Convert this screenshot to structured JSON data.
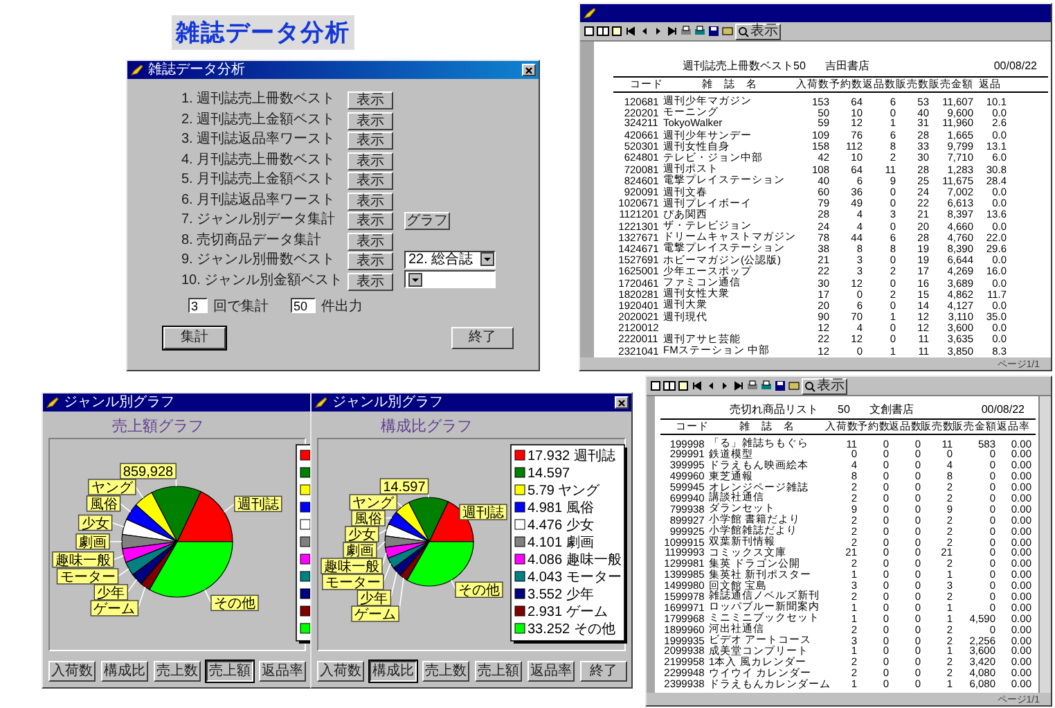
{
  "heading": "雑誌データ分析",
  "dialog": {
    "title": "雑誌データ分析",
    "items": [
      {
        "label": "1. 週刊誌売上冊数ベスト",
        "button": "表示"
      },
      {
        "label": "2. 週刊誌売上金額ベスト",
        "button": "表示"
      },
      {
        "label": "3. 週刊誌返品率ワースト",
        "button": "表示"
      },
      {
        "label": "4. 月刊誌売上冊数ベスト",
        "button": "表示"
      },
      {
        "label": "5. 月刊誌売上金額ベスト",
        "button": "表示"
      },
      {
        "label": "6. 月刊誌返品率ワースト",
        "button": "表示"
      },
      {
        "label": "7. ジャンル別データ集計",
        "button": "表示",
        "extra": {
          "kind": "button",
          "label": "グラフ"
        }
      },
      {
        "label": "8. 売切商品データ集計",
        "button": "表示"
      },
      {
        "label": "9. ジャンル別冊数ベスト",
        "button": "表示",
        "extra": {
          "kind": "dropdown",
          "value": "22. 総合誌"
        }
      },
      {
        "label": "10. ジャンル別金額ベスト",
        "button": "表示",
        "extra": {
          "kind": "dropdown"
        }
      }
    ],
    "period": {
      "value": "3",
      "label": "回で集計"
    },
    "count": {
      "value": "50",
      "label": "件出力"
    },
    "buttons": [
      "集計",
      "終了"
    ]
  },
  "reports": [
    {
      "toolbar_button": "表示",
      "title": "週刊誌売上冊数ベスト50",
      "store": "吉田書店",
      "date": "00/08/22",
      "page": "ページ1/1",
      "columns": [
        "",
        "コード",
        "雑　誌　名",
        "入荷数",
        "予約数",
        "返品数",
        "販売数",
        "販売金額",
        "返品"
      ],
      "rows": [
        [
          "1",
          "20681",
          "週刊少年マガジン",
          "153",
          "64",
          "6",
          "53",
          "11,607",
          "10.1"
        ],
        [
          "2",
          "20201",
          "モーニング",
          "50",
          "10",
          "0",
          "40",
          "9,600",
          "0.0"
        ],
        [
          "3",
          "24211",
          "TokyoWalker",
          "59",
          "12",
          "1",
          "31",
          "11,960",
          "2.6"
        ],
        [
          "4",
          "20661",
          "週刊少年サンデー",
          "109",
          "76",
          "6",
          "28",
          "1,665",
          "0.0"
        ],
        [
          "5",
          "20301",
          "週刊女性自身",
          "158",
          "112",
          "8",
          "33",
          "9,799",
          "13.1"
        ],
        [
          "6",
          "24801",
          "テレビ・ジョン中部",
          "42",
          "10",
          "2",
          "30",
          "7,710",
          "6.0"
        ],
        [
          "7",
          "20081",
          "週刊ポスト",
          "108",
          "64",
          "11",
          "28",
          "1,283",
          "30.8"
        ],
        [
          "8",
          "24601",
          "電撃プレイステーション",
          "40",
          "6",
          "9",
          "25",
          "11,675",
          "28.4"
        ],
        [
          "9",
          "20091",
          "週刊文春",
          "60",
          "36",
          "0",
          "24",
          "7,002",
          "0.0"
        ],
        [
          "10",
          "20671",
          "週刊プレイボーイ",
          "79",
          "49",
          "0",
          "22",
          "6,613",
          "0.0"
        ],
        [
          "11",
          "21201",
          "ぴあ関西",
          "28",
          "4",
          "3",
          "21",
          "8,397",
          "13.6"
        ],
        [
          "12",
          "21301",
          "ザ・テレビジョン",
          "24",
          "4",
          "0",
          "20",
          "4,660",
          "0.0"
        ],
        [
          "13",
          "27671",
          "ドリームキャストマガジン",
          "78",
          "44",
          "6",
          "28",
          "4,760",
          "22.0"
        ],
        [
          "14",
          "24671",
          "電撃プレイステーション",
          "38",
          "8",
          "8",
          "19",
          "8,390",
          "29.6"
        ],
        [
          "15",
          "27691",
          "ホビーマガジン(公認版)",
          "21",
          "3",
          "0",
          "19",
          "6,644",
          "0.0"
        ],
        [
          "16",
          "25001",
          "少年エースポップ",
          "22",
          "3",
          "2",
          "17",
          "4,269",
          "16.0"
        ],
        [
          "17",
          "20461",
          "ファミコン通信",
          "30",
          "12",
          "0",
          "16",
          "3,689",
          "0.0"
        ],
        [
          "18",
          "20281",
          "週刊女性大衆",
          "17",
          "0",
          "2",
          "15",
          "4,862",
          "11.7"
        ],
        [
          "19",
          "20401",
          "週刊大衆",
          "20",
          "6",
          "0",
          "14",
          "4,127",
          "0.0"
        ],
        [
          "20",
          "20021",
          "週刊現代",
          "90",
          "70",
          "1",
          "12",
          "3,110",
          "35.0"
        ],
        [
          "21",
          "20012",
          null,
          "12",
          "4",
          "0",
          "12",
          "3,600",
          "0.0"
        ],
        [
          "22",
          "20011",
          "週刊アサヒ芸能",
          "22",
          "12",
          "0",
          "11",
          "3,635",
          "0.0"
        ],
        [
          "23",
          "21041",
          "FMステーション 中部",
          "12",
          "0",
          "1",
          "11",
          "3,850",
          "8.3"
        ]
      ]
    },
    {
      "toolbar_button": "表示",
      "title": "売切れ商品リスト",
      "count": "50",
      "store": "文創書店",
      "date": "00/08/22",
      "page": "ページ1/1",
      "columns": [
        "",
        "コード",
        "雑　誌　名",
        "入荷数",
        "予約数",
        "返品数",
        "販売数",
        "販売金額",
        "返品率"
      ],
      "rows": [
        [
          "1",
          "99998",
          "「る」雑誌ちもぐら",
          "11",
          "0",
          "0",
          "11",
          "583",
          "0.00"
        ],
        [
          "2",
          "99991",
          "鉄道模型",
          "0",
          "0",
          "0",
          "0",
          "0",
          "0.00"
        ],
        [
          "3",
          "99995",
          "ドラえもん映画絵本",
          "4",
          "0",
          "0",
          "4",
          "0",
          "0.00"
        ],
        [
          "4",
          "99960",
          "東芝通報",
          "8",
          "0",
          "0",
          "8",
          "0",
          "0.00"
        ],
        [
          "5",
          "99945",
          "オレンジページ雑誌",
          "2",
          "0",
          "0",
          "2",
          "0",
          "0.00"
        ],
        [
          "6",
          "99940",
          "講談社通信",
          "2",
          "0",
          "0",
          "2",
          "0",
          "0.00"
        ],
        [
          "7",
          "99938",
          "ダランセット",
          "9",
          "0",
          "0",
          "9",
          "0",
          "0.00"
        ],
        [
          "8",
          "99927",
          "小学館 書籍だより",
          "2",
          "0",
          "0",
          "2",
          "0",
          "0.00"
        ],
        [
          "9",
          "99925",
          "小学館雑誌だより",
          "2",
          "0",
          "0",
          "2",
          "0",
          "0.00"
        ],
        [
          "10",
          "99915",
          "双葉新刊情報",
          "2",
          "0",
          "0",
          "2",
          "0",
          "0.00"
        ],
        [
          "11",
          "99993",
          "コミックス文庫",
          "21",
          "0",
          "0",
          "21",
          "0",
          "0.00"
        ],
        [
          "12",
          "99981",
          "集英 ドラゴン公開",
          "2",
          "0",
          "0",
          "2",
          "0",
          "0.00"
        ],
        [
          "13",
          "99985",
          "集英社 新刊ポスター",
          "1",
          "0",
          "0",
          "1",
          "0",
          "0.00"
        ],
        [
          "14",
          "99980",
          "回文館 宝島",
          "3",
          "0",
          "0",
          "3",
          "0",
          "0.00"
        ],
        [
          "15",
          "99978",
          "雑誌通信ノベルズ新刊",
          "2",
          "0",
          "0",
          "2",
          "0",
          "0.00"
        ],
        [
          "16",
          "99971",
          "ロッパブルー新聞案内",
          "1",
          "0",
          "0",
          "1",
          "0",
          "0.00"
        ],
        [
          "17",
          "99968",
          "ミニミニブックセット",
          "1",
          "0",
          "0",
          "1",
          "4,590",
          "0.00"
        ],
        [
          "18",
          "99960",
          "河出社通信",
          "2",
          "0",
          "0",
          "2",
          "0",
          "0.00"
        ],
        [
          "19",
          "99935",
          "ビデオ アートコース",
          "3",
          "0",
          "0",
          "2",
          "2,256",
          "0.00"
        ],
        [
          "20",
          "99938",
          "成美堂コンプリート",
          "1",
          "0",
          "0",
          "1",
          "3,600",
          "0.00"
        ],
        [
          "21",
          "99958",
          "1本入 風カレンダー",
          "2",
          "0",
          "0",
          "2",
          "3,420",
          "0.00"
        ],
        [
          "22",
          "99948",
          "ウイウイ カレンダー",
          "2",
          "0",
          "0",
          "2",
          "4,080",
          "0.00"
        ],
        [
          "23",
          "99938",
          "ドラえもんカレンダーム",
          "1",
          "0",
          "0",
          "1",
          "6,080",
          "0.00"
        ]
      ]
    }
  ],
  "charts": [
    {
      "title": "ジャンル別グラフ",
      "subtitle": "売上額グラフ",
      "chart_data": {
        "type": "pie",
        "categories": [
          "週刊誌",
          "859,928",
          "ヤング",
          "風俗",
          "少女",
          "劇画",
          "趣味一般",
          "モーター",
          "少年",
          "ゲーム",
          "その他"
        ],
        "values": [
          17.932,
          14.597,
          5.79,
          4.981,
          4.476,
          4.101,
          4.086,
          4.043,
          3.552,
          2.931,
          33.252
        ]
      },
      "legend": [
        {
          "color": "#ff0000"
        },
        {
          "color": "#008000"
        },
        {
          "color": "#ffff00"
        },
        {
          "color": "#0000ff"
        },
        {
          "color": "#ffffff"
        },
        {
          "color": "#808080"
        },
        {
          "color": "#ff00ff"
        },
        {
          "color": "#008080"
        },
        {
          "color": "#000080"
        },
        {
          "color": "#800000"
        },
        {
          "color": "#00ff00"
        }
      ],
      "buttons": [
        {
          "label": "入荷数",
          "selected": false
        },
        {
          "label": "構成比",
          "selected": false
        },
        {
          "label": "売上数",
          "selected": false
        },
        {
          "label": "売上額",
          "selected": true
        },
        {
          "label": "返品率",
          "selected": false
        }
      ]
    },
    {
      "title": "ジャンル別グラフ",
      "subtitle": "構成比グラフ",
      "chart_data": {
        "type": "pie",
        "categories": [
          "週刊誌",
          "14.597",
          "ヤング",
          "風俗",
          "少女",
          "劇画",
          "趣味一般",
          "モーター",
          "少年",
          "ゲーム",
          "その他"
        ],
        "values": [
          17.932,
          14.597,
          5.79,
          4.981,
          4.476,
          4.101,
          4.086,
          4.043,
          3.552,
          2.931,
          33.252
        ]
      },
      "legend": [
        {
          "label": "17.932 週刊誌",
          "color": "#ff0000"
        },
        {
          "label": "14.597",
          "color": "#008000"
        },
        {
          "label": "5.79 ヤング",
          "color": "#ffff00"
        },
        {
          "label": "4.981 風俗",
          "color": "#0000ff"
        },
        {
          "label": "4.476 少女",
          "color": "#ffffff"
        },
        {
          "label": "4.101 劇画",
          "color": "#808080"
        },
        {
          "label": "4.086 趣味一般",
          "color": "#ff00ff"
        },
        {
          "label": "4.043 モーター",
          "color": "#008080"
        },
        {
          "label": "3.552 少年",
          "color": "#000080"
        },
        {
          "label": "2.931 ゲーム",
          "color": "#800000"
        },
        {
          "label": "33.252 その他",
          "color": "#00ff00"
        }
      ],
      "buttons": [
        {
          "label": "入荷数",
          "selected": false
        },
        {
          "label": "構成比",
          "selected": true
        },
        {
          "label": "売上数",
          "selected": false
        },
        {
          "label": "売上額",
          "selected": false
        },
        {
          "label": "返品率",
          "selected": false
        },
        {
          "label": "終了",
          "selected": false
        }
      ]
    }
  ]
}
